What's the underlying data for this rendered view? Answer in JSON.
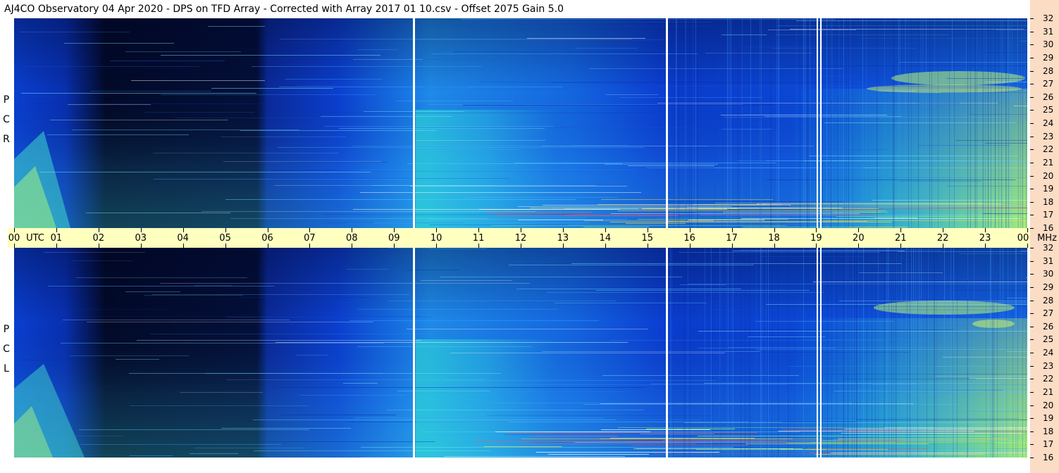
{
  "title": "AJ4CO Observatory  04 Apr 2020  -  DPS on TFD Array  -  Corrected with Array 2017 01 10.csv  -  Offset 2075  Gain 5.0",
  "panels": [
    {
      "letters": [
        "R",
        "C",
        "P"
      ]
    },
    {
      "letters": [
        "L",
        "C",
        "P"
      ]
    }
  ],
  "utc": {
    "labels": [
      "00",
      "01",
      "02",
      "03",
      "04",
      "05",
      "06",
      "07",
      "08",
      "09",
      "10",
      "11",
      "12",
      "13",
      "14",
      "15",
      "16",
      "17",
      "18",
      "19",
      "20",
      "21",
      "22",
      "23",
      "00"
    ],
    "unit_left": "UTC",
    "unit_right": "MHz"
  },
  "chart_data": {
    "type": "heatmap",
    "title": "AJ4CO Observatory  04 Apr 2020  -  DPS on TFD Array  -  Corrected with Array 2017 01 10.csv  -  Offset 2075  Gain 5.0",
    "x": {
      "unit": "UTC",
      "range_hours": [
        0,
        24
      ],
      "tick_labels": [
        "00",
        "01",
        "02",
        "03",
        "04",
        "05",
        "06",
        "07",
        "08",
        "09",
        "10",
        "11",
        "12",
        "13",
        "14",
        "15",
        "16",
        "17",
        "18",
        "19",
        "20",
        "21",
        "22",
        "23",
        "00"
      ]
    },
    "y": {
      "unit": "MHz",
      "range": [
        16,
        32
      ],
      "tick_labels": [
        "32",
        "31",
        "30",
        "29",
        "28",
        "27",
        "26",
        "25",
        "24",
        "23",
        "22",
        "21",
        "20",
        "19",
        "18",
        "17",
        "16"
      ]
    },
    "series": [
      {
        "name": "RCP"
      },
      {
        "name": "LCP"
      }
    ],
    "data_gaps_utc_hours": [
      9.45,
      15.45,
      19.0,
      19.07
    ]
  }
}
